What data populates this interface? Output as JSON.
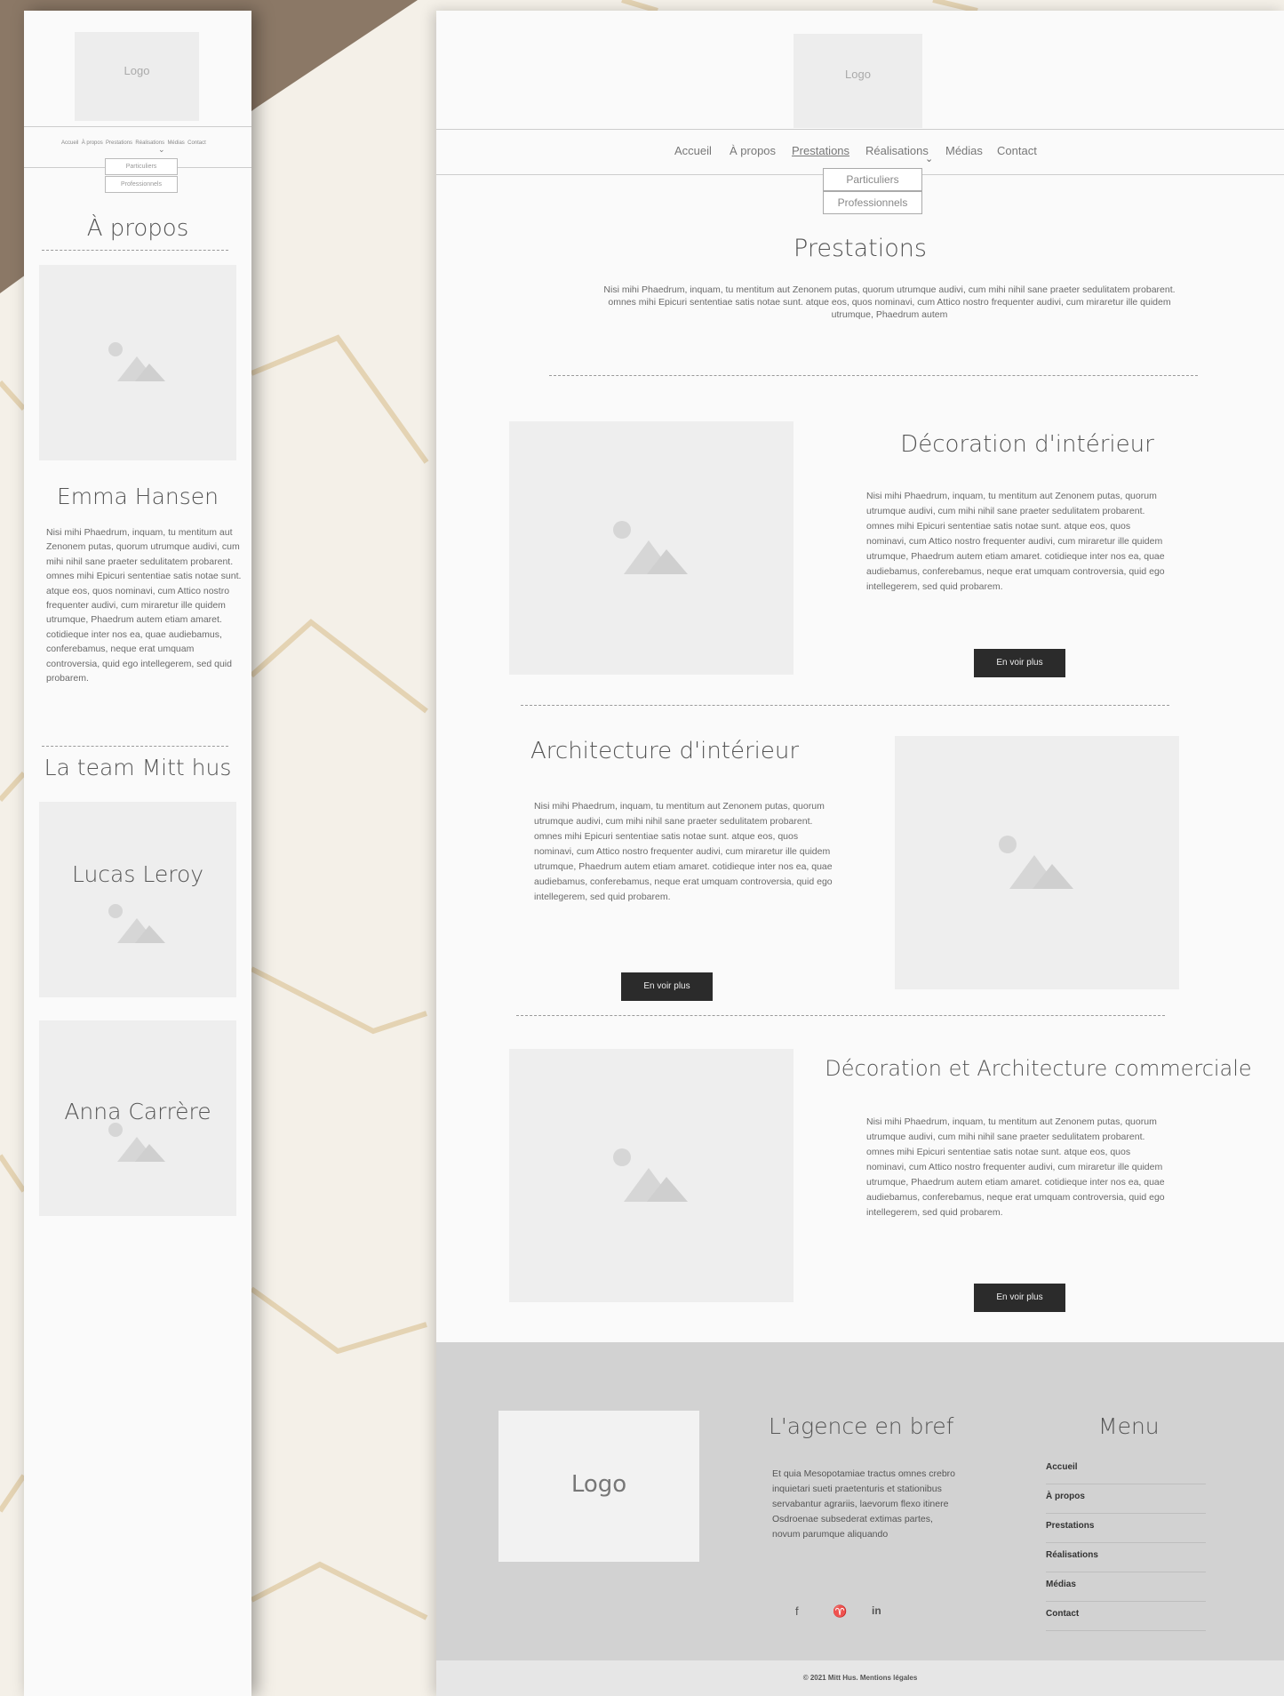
{
  "colors": {
    "button_bg": "#2b2b2b",
    "footer_bg": "#d2d2d2",
    "placeholder": "#eeeeee"
  },
  "mobile": {
    "logo": "Logo",
    "nav_items": [
      "Accueil",
      "À propos",
      "Prestations",
      "Réalisations",
      "Médias",
      "Contact"
    ],
    "dropdown": [
      "Particuliers",
      "Professionnels"
    ],
    "about_title": "À propos",
    "person_name": "Emma Hansen",
    "person_text": "Nisi mihi Phaedrum, inquam, tu mentitum aut Zenonem putas, quorum utrumque audivi, cum mihi nihil sane praeter sedulitatem probarent. omnes mihi Epicuri sententiae satis notae sunt. atque eos, quos nominavi, cum Attico nostro frequenter audivi, cum miraretur ille quidem utrumque, Phaedrum autem etiam amaret. cotidieque inter nos ea, quae audiebamus, conferebamus, neque erat umquam controversia, quid ego intellegerem, sed quid probarem.",
    "team_title": "La team Mitt hus",
    "team": [
      "Lucas Leroy",
      "Anna Carrère"
    ]
  },
  "desktop": {
    "logo": "Logo",
    "nav_items": [
      "Accueil",
      "À propos",
      "Prestations",
      "Réalisations",
      "Médias",
      "Contact"
    ],
    "dropdown": [
      "Particuliers",
      "Professionnels"
    ],
    "page_title": "Prestations",
    "intro": "Nisi mihi Phaedrum, inquam, tu mentitum aut Zenonem putas, quorum utrumque audivi, cum mihi nihil sane praeter sedulitatem probarent. omnes mihi Epicuri sententiae satis notae sunt. atque eos, quos nominavi, cum Attico nostro frequenter audivi, cum miraretur ille quidem utrumque, Phaedrum autem",
    "sections": [
      {
        "title": "Décoration d'intérieur",
        "text": "Nisi mihi Phaedrum, inquam, tu mentitum aut Zenonem putas, quorum utrumque audivi, cum mihi nihil sane praeter sedulitatem probarent. omnes mihi Epicuri sententiae satis notae sunt. atque eos, quos nominavi, cum Attico nostro frequenter audivi, cum miraretur ille quidem utrumque, Phaedrum autem etiam amaret. cotidieque inter nos ea, quae audiebamus, conferebamus, neque erat umquam controversia, quid ego intellegerem, sed quid probarem.",
        "button": "En voir plus"
      },
      {
        "title": "Architecture d'intérieur",
        "text": "Nisi mihi Phaedrum, inquam, tu mentitum aut Zenonem putas, quorum utrumque audivi, cum mihi nihil sane praeter sedulitatem probarent. omnes mihi Epicuri sententiae satis notae sunt. atque eos, quos nominavi, cum Attico nostro frequenter audivi, cum miraretur ille quidem utrumque, Phaedrum autem etiam amaret. cotidieque inter nos ea, quae audiebamus, conferebamus, neque erat umquam controversia, quid ego intellegerem, sed quid probarem.",
        "button": "En voir plus"
      },
      {
        "title": "Décoration et Architecture commerciale",
        "text": "Nisi mihi Phaedrum, inquam, tu mentitum aut Zenonem putas, quorum utrumque audivi, cum mihi nihil sane praeter sedulitatem probarent. omnes mihi Epicuri sententiae satis notae sunt. atque eos, quos nominavi, cum Attico nostro frequenter audivi, cum miraretur ille quidem utrumque, Phaedrum autem etiam amaret. cotidieque inter nos ea, quae audiebamus, conferebamus, neque erat umquam controversia, quid ego intellegerem, sed quid probarem.",
        "button": "En voir plus"
      }
    ],
    "footer": {
      "logo": "Logo",
      "agency_title": "L'agence en bref",
      "agency_text": "Et quia Mesopotamiae tractus omnes crebro inquietari sueti praetenturis et stationibus servabantur agrariis, laevorum flexo itinere Osdroenae subsederat extimas partes, novum parumque aliquando",
      "menu_title": "Menu",
      "menu_items": [
        "Accueil",
        "À propos",
        "Prestations",
        "Réalisations",
        "Médias",
        "Contact"
      ],
      "social_icons": [
        "facebook-icon",
        "twitter-icon",
        "linkedin-icon"
      ],
      "copyright": "© 2021 Mitt Hus.  Mentions légales"
    }
  }
}
